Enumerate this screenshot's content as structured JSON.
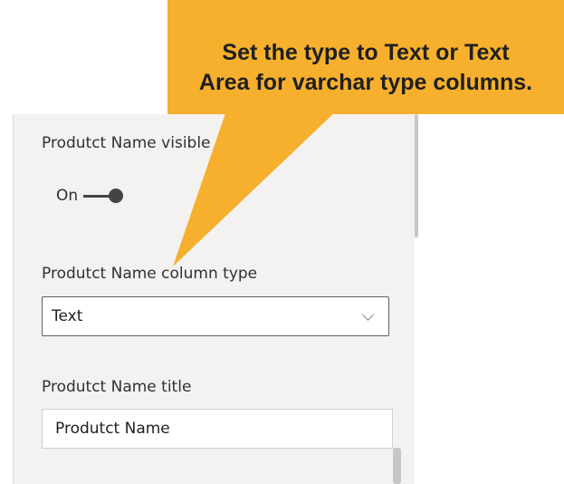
{
  "settings": {
    "visible_label": "Produtct Name visible",
    "toggle_state": "On",
    "column_type_label": "Produtct Name column type",
    "column_type_value": "Text",
    "title_label": "Produtct Name title",
    "title_value": "Produtct Name"
  },
  "callout": {
    "line1": "Set the type to Text or Text",
    "line2": "Area for varchar type columns."
  },
  "colors": {
    "callout_bg": "#f6b02d",
    "panel_bg": "#f3f2f1"
  },
  "icons": {
    "dropdown": "chevron-down-icon"
  }
}
